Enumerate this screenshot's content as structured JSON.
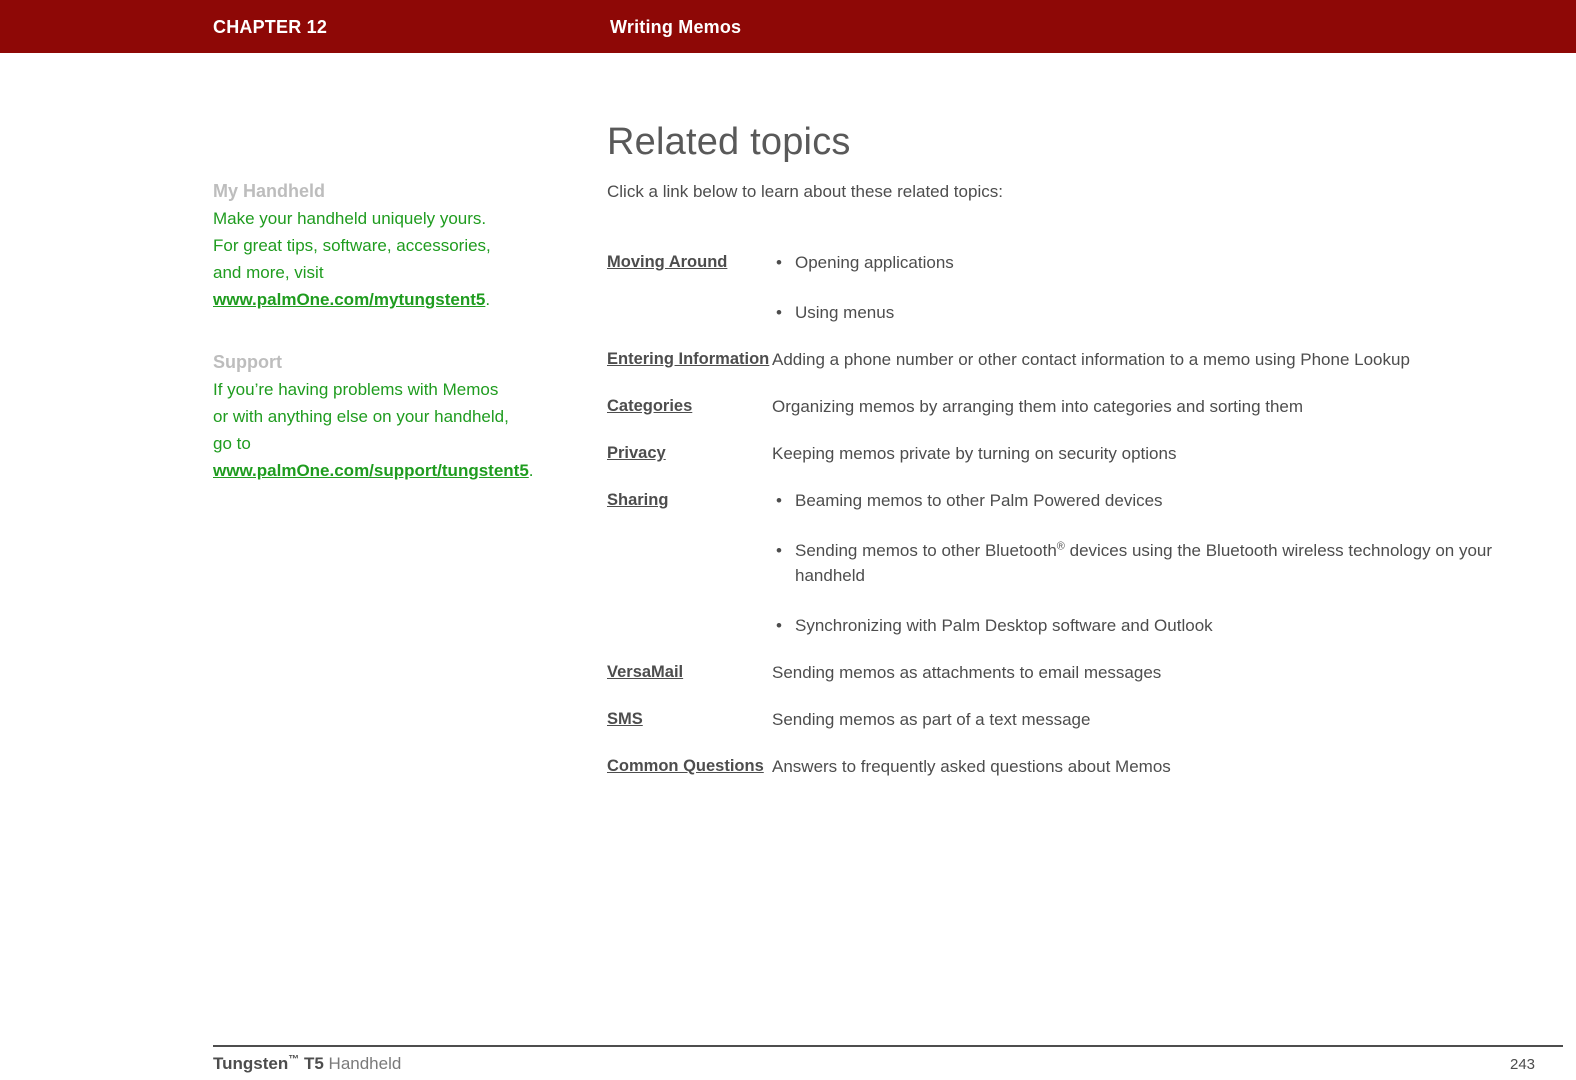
{
  "header": {
    "chapter_label": "CHAPTER 12",
    "chapter_title": "Writing Memos",
    "bar_color": "#8e0806"
  },
  "sidebar": {
    "blocks": [
      {
        "heading": "My Handheld",
        "body": "Make your handheld uniquely yours. For great tips, software, accessories, and more, visit ",
        "link": "www.palmOne.com/mytungstent5",
        "trailing": "."
      },
      {
        "heading": "Support",
        "body": "If you’re having problems with Memos or with anything else on your handheld, go to ",
        "link": "www.palmOne.com/support/tungstent5",
        "trailing": "."
      }
    ],
    "heading_color": "#bdbdbd",
    "text_color": "#1f9c1f"
  },
  "main": {
    "title": "Related topics",
    "intro": "Click a link below to learn about these related topics:"
  },
  "topics": [
    {
      "link": "Moving Around",
      "bullets": [
        "Opening applications",
        "Using menus"
      ]
    },
    {
      "link": "Entering Information",
      "description": "Adding a phone number or other contact information to a memo using Phone Lookup"
    },
    {
      "link": "Categories",
      "description": "Organizing memos by arranging them into categories and sorting them"
    },
    {
      "link": "Privacy",
      "description": "Keeping memos private by turning on security options"
    },
    {
      "link": "Sharing",
      "bullets": [
        "Beaming memos to other Palm Powered devices",
        "Sending memos to other Bluetooth® devices using the Bluetooth wireless technology on your handheld",
        "Synchronizing with Palm Desktop software and Outlook"
      ],
      "bullet_html_index": 1,
      "bullet_html": "Sending memos to other Bluetooth<sup class=\"reg\">®</sup> devices using the Bluetooth wireless technology on your handheld"
    },
    {
      "link": "VersaMail",
      "description": "Sending memos as attachments to email messages"
    },
    {
      "link": "SMS",
      "description": "Sending memos as part of a text message"
    },
    {
      "link": "Common Questions",
      "description": "Answers to frequently asked questions about Memos"
    }
  ],
  "footer": {
    "product_bold": "Tungsten",
    "product_tm": "™",
    "product_model": "T5",
    "product_suffix": " Handheld",
    "page_number": "243"
  },
  "icons": {
    "bullet": "•"
  }
}
